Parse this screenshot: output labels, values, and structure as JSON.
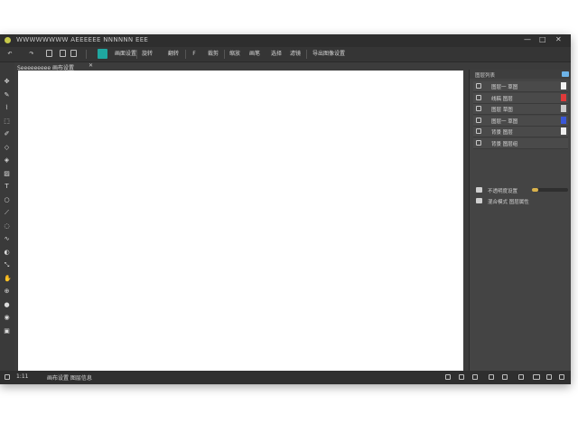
{
  "window": {
    "title": "WWWWWWWW AEEEEEE NNNNNN EEE",
    "controls": {
      "minimize": "—",
      "maximize": "□",
      "close": "✕"
    }
  },
  "toolbar": {
    "undo_label": "↶",
    "redo_label": "↷",
    "btn_a": "画面设置",
    "btn_b": "旋转",
    "btn_c": "翻转",
    "btn_d": "裁剪",
    "btn_e": "缩放",
    "btn_f": "画笔",
    "btn_g": "选择",
    "btn_h": "滤镜",
    "btn_i": "导出图像设置"
  },
  "document_tab": {
    "label": "Seeeeeeeee 画布设置",
    "close": "✕"
  },
  "tools": [
    {
      "icon": "move-icon",
      "glyph": "✥"
    },
    {
      "icon": "pen-icon",
      "glyph": "✎"
    },
    {
      "icon": "lasso-icon",
      "glyph": "⌇"
    },
    {
      "icon": "select-icon",
      "glyph": "⬚"
    },
    {
      "icon": "brush-icon",
      "glyph": "✐"
    },
    {
      "icon": "eraser-icon",
      "glyph": "◇"
    },
    {
      "icon": "bucket-icon",
      "glyph": "◈"
    },
    {
      "icon": "gradient-icon",
      "glyph": "▨"
    },
    {
      "icon": "text-icon",
      "glyph": "T"
    },
    {
      "icon": "shape-icon",
      "glyph": "○"
    },
    {
      "icon": "eyedropper-icon",
      "glyph": "⟋"
    },
    {
      "icon": "blur-icon",
      "glyph": "◌"
    },
    {
      "icon": "smudge-icon",
      "glyph": "∿"
    },
    {
      "icon": "dodge-icon",
      "glyph": "◐"
    },
    {
      "icon": "transform-icon",
      "glyph": "⤡"
    },
    {
      "icon": "hand-icon",
      "glyph": "✋"
    },
    {
      "icon": "zoom-icon",
      "glyph": "⊕"
    },
    {
      "icon": "color-icon",
      "glyph": "●"
    },
    {
      "icon": "mask-icon",
      "glyph": "◉"
    },
    {
      "icon": "screen-icon",
      "glyph": "▣"
    }
  ],
  "layers_panel": {
    "title": "图层列表",
    "layers": [
      {
        "name": "图层一 草图",
        "swatch": "#f2f2f2"
      },
      {
        "name": "线稿 图层",
        "swatch": "#e03a3a"
      },
      {
        "name": "图层 草图",
        "swatch": "#cccccc"
      },
      {
        "name": "图层一 草图",
        "swatch": "#3a57d8"
      },
      {
        "name": "背景 图层",
        "swatch": "#eeeeee"
      },
      {
        "name": "背景 图层组",
        "swatch": ""
      }
    ],
    "opacity_label": "不透明度设置",
    "opacity_fraction": 0.18,
    "blend_label": "混合模式 图层属性"
  },
  "status": {
    "zoom": "1:11",
    "info": "画布设置 图层信息"
  }
}
